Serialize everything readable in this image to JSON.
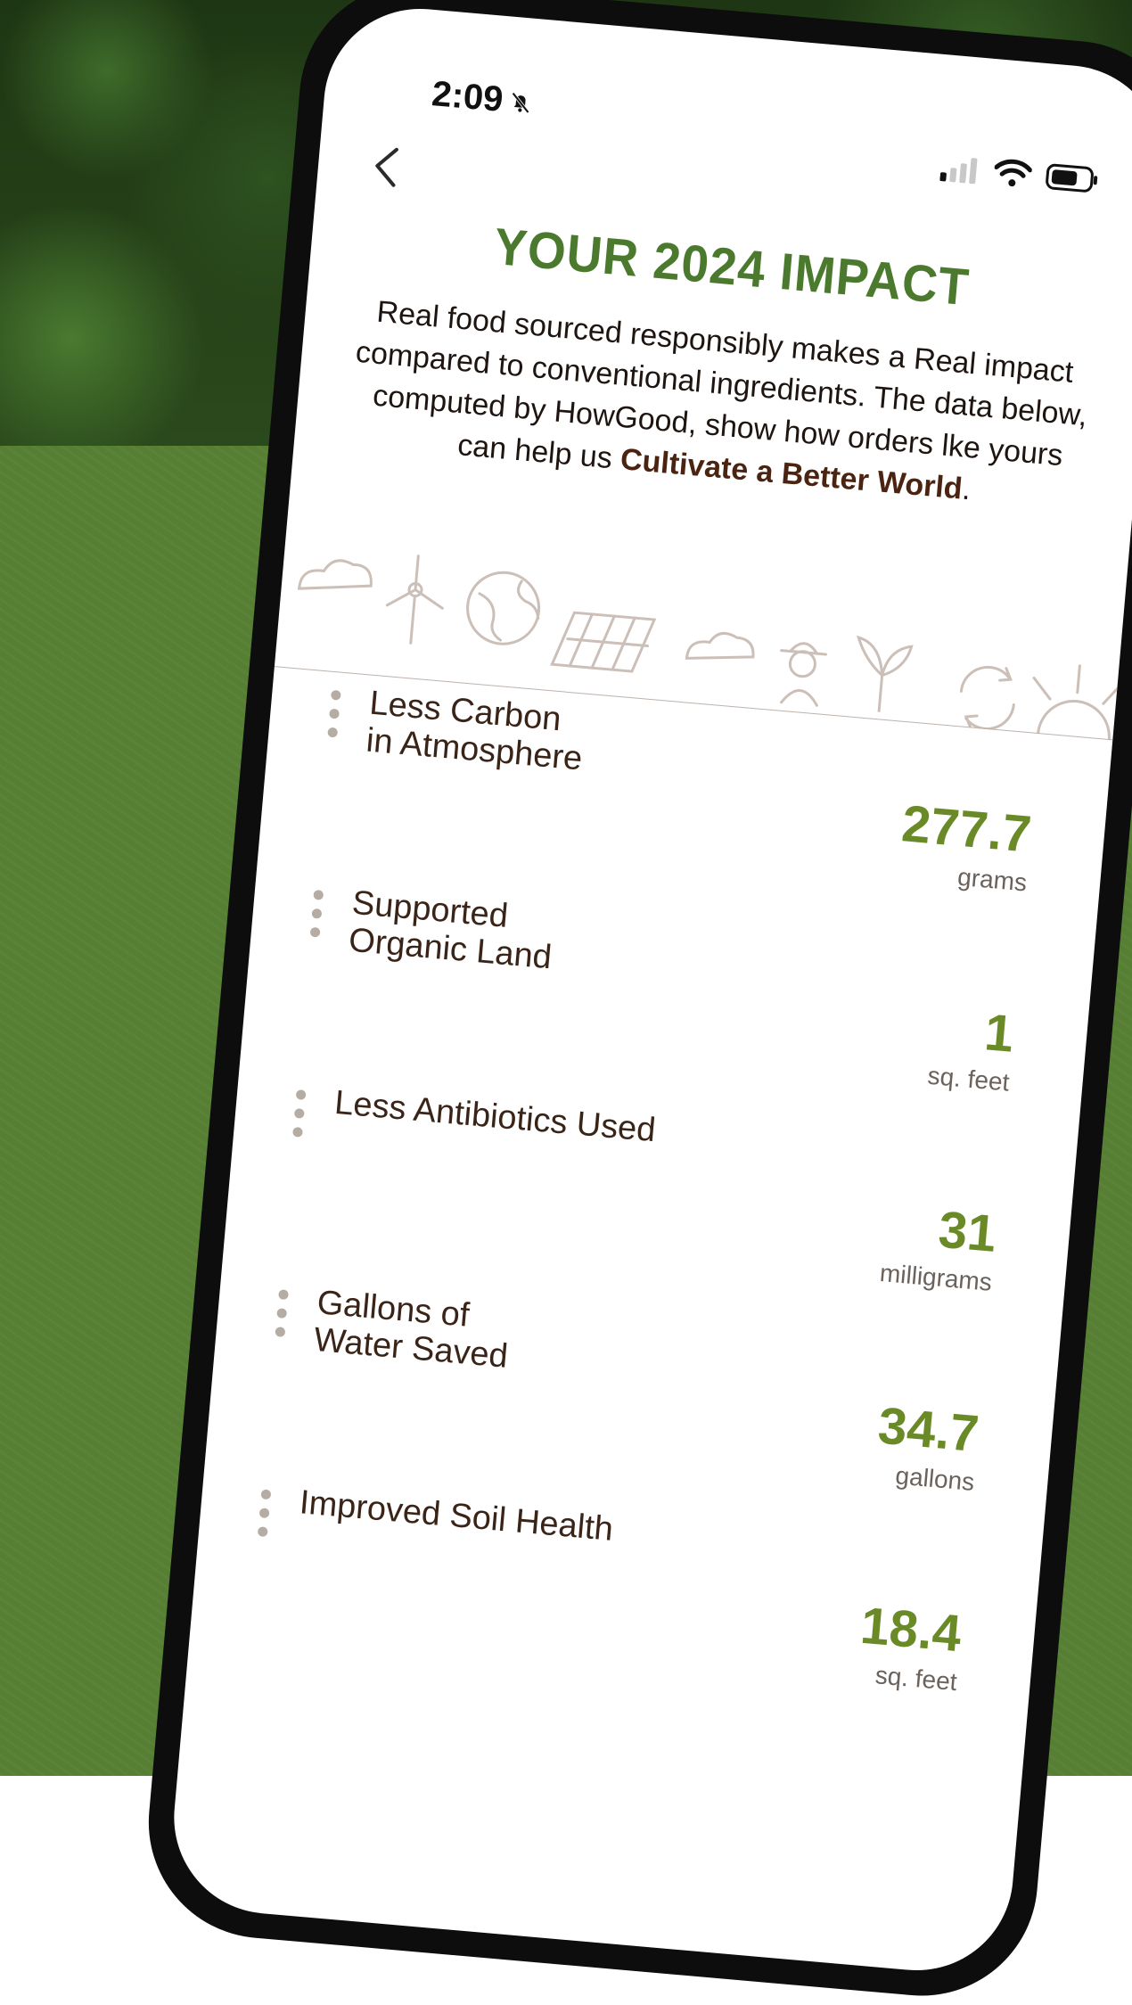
{
  "status_bar": {
    "time": "2:09"
  },
  "header": {
    "title": "YOUR 2024 IMPACT",
    "intro_text": "Real food sourced responsibly makes a Real impact compared to conventional ingredients. The data below, computed by HowGood, show how orders lke yours can help us ",
    "intro_emphasis": "Cultivate a Better World",
    "intro_end": "."
  },
  "impacts": [
    {
      "label": "Less Carbon\nin Atmosphere",
      "value": "277.7",
      "unit": "grams"
    },
    {
      "label": "Supported\nOrganic Land",
      "value": "1",
      "unit": "sq. feet"
    },
    {
      "label": "Less Antibiotics Used",
      "value": "31",
      "unit": "milligrams"
    },
    {
      "label": "Gallons of\nWater Saved",
      "value": "34.7",
      "unit": "gallons"
    },
    {
      "label": "Improved Soil Health",
      "value": "18.4",
      "unit": "sq. feet"
    }
  ],
  "colors": {
    "title": "#4b7a2e",
    "value": "#6a8a28",
    "emphasis": "#4a2410",
    "background": "#567f34"
  },
  "icons": [
    "bell-slash-icon",
    "signal-icon",
    "wifi-icon",
    "battery-icon",
    "back-chevron-icon",
    "cloud-icon",
    "windmill-icon",
    "globe-icon",
    "solar-panel-icon",
    "farmer-icon",
    "sprout-icon",
    "recycle-icon",
    "sun-icon",
    "drag-handle-icon"
  ]
}
